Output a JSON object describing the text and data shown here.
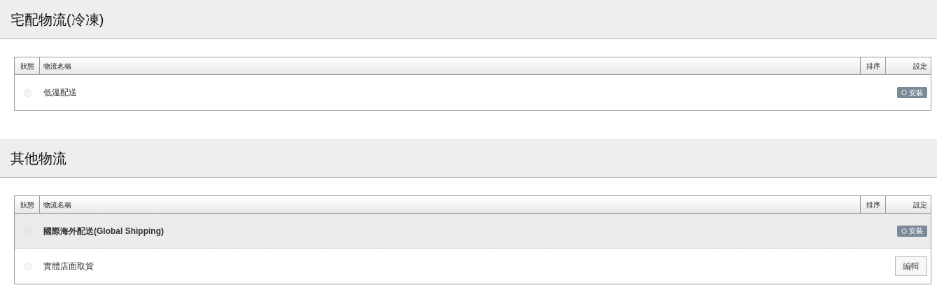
{
  "sections": [
    {
      "title": "宅配物流(冷凍)",
      "columns": [
        "狀態",
        "物流名稱",
        "排序",
        "設定"
      ],
      "rows": [
        {
          "name": "低溫配送",
          "highlighted": false,
          "action": {
            "kind": "install",
            "label": "安裝"
          }
        }
      ]
    },
    {
      "title": "其他物流",
      "columns": [
        "狀態",
        "物流名稱",
        "排序",
        "設定"
      ],
      "rows": [
        {
          "name": "國際海外配送(Global Shipping)",
          "highlighted": true,
          "action": {
            "kind": "install",
            "label": "安裝"
          }
        },
        {
          "name": "實體店面取貨",
          "highlighted": false,
          "action": {
            "kind": "edit",
            "label": "編輯"
          }
        }
      ]
    }
  ]
}
